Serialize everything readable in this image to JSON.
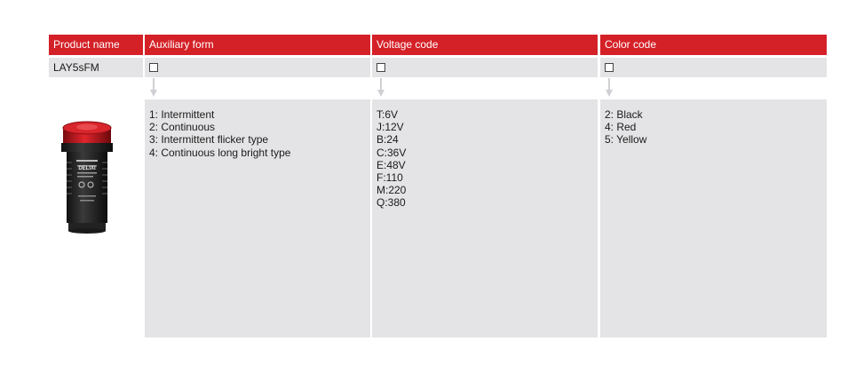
{
  "table": {
    "headers": {
      "product_name": "Product name",
      "auxiliary_form": "Auxiliary form",
      "voltage_code": "Voltage code",
      "color_code": "Color code"
    },
    "model": "LAY5sFM",
    "auxiliary_options": [
      "1: Intermittent",
      "2: Continuous",
      "3: Intermittent flicker type",
      "4: Continuous long bright type"
    ],
    "voltage_options": [
      "T:6V",
      "J:12V",
      "B:24",
      "C:36V",
      "E:48V",
      "F:110",
      "M:220",
      "Q:380"
    ],
    "color_options": [
      "2: Black",
      "4: Red",
      "5: Yellow"
    ]
  },
  "product_image": {
    "brand_text": "DELIXI",
    "icon": "buzzer-indicator-product-photo"
  },
  "colors": {
    "header_bg": "#d42127",
    "cell_bg": "#e4e4e6"
  }
}
